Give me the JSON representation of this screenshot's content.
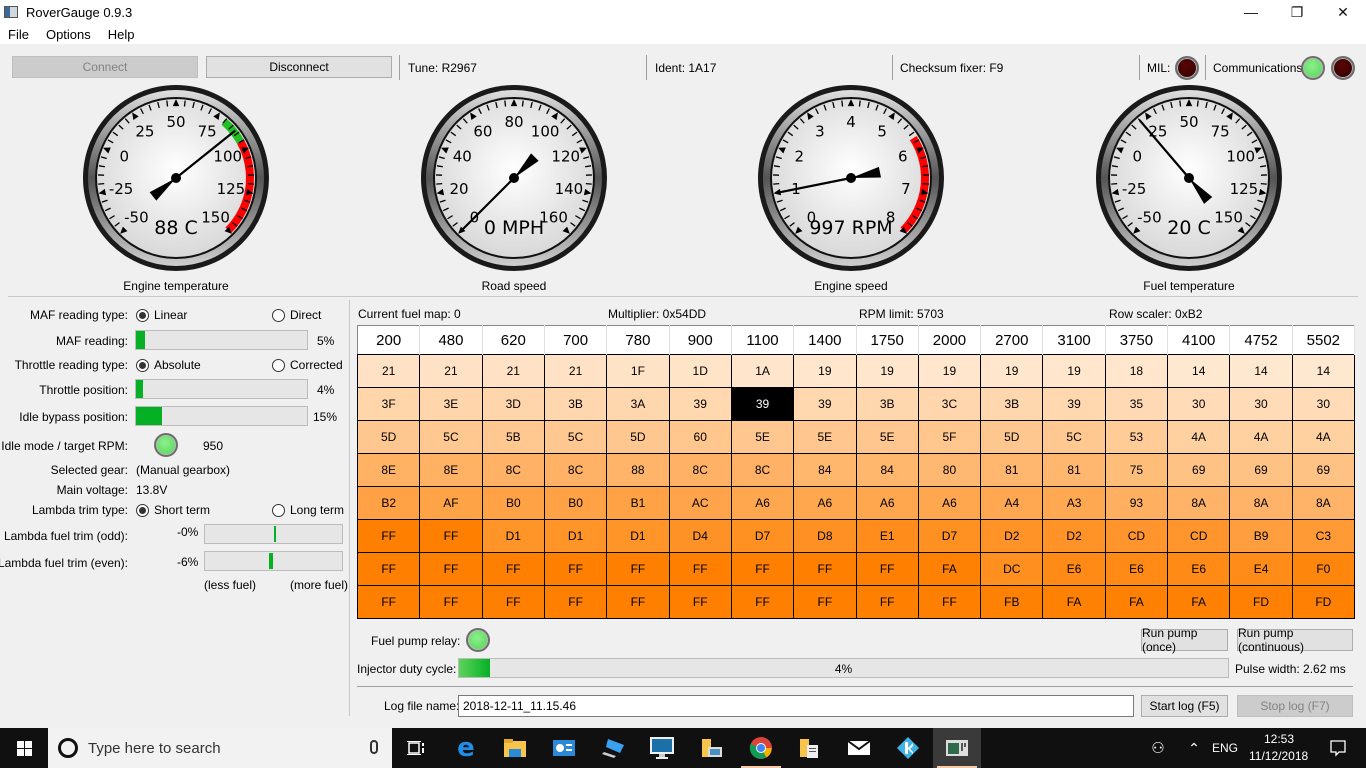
{
  "window": {
    "title": "RoverGauge 0.9.3",
    "controls": {
      "minimize": "—",
      "restore": "❐",
      "close": "✕"
    }
  },
  "menu": [
    "File",
    "Options",
    "Help"
  ],
  "toolbar": {
    "connect_label": "Connect",
    "connect_enabled": false,
    "disconnect_label": "Disconnect",
    "tune": "Tune: R2967",
    "ident": "Ident: 1A17",
    "checksum": "Checksum fixer: F9",
    "mil_label": "MIL:",
    "mil_state": "off",
    "comms_label": "Communications:",
    "comms_rx_state": "on",
    "comms_tx_state": "off"
  },
  "colors": {
    "led_on": "#4ed34e",
    "led_off": "#2a0000",
    "progress_fill": "#06b025",
    "redline": "#ff0000",
    "green_zone": "#1fc01f"
  },
  "gauges": [
    {
      "id": "engine-temp",
      "caption": "Engine temperature",
      "readout": "88 C",
      "value": 88,
      "min": -50,
      "max": 150,
      "ticks": [
        "-50",
        "-25",
        "0",
        "25",
        "50",
        "75",
        "100",
        "125",
        "150"
      ],
      "green_zone": [
        80,
        95
      ],
      "red_zone": [
        95,
        150
      ]
    },
    {
      "id": "road-speed",
      "caption": "Road speed",
      "readout": "0 MPH",
      "value": 0,
      "min": 0,
      "max": 160,
      "ticks": [
        "0",
        "20",
        "40",
        "60",
        "80",
        "100",
        "120",
        "140",
        "160"
      ],
      "green_zone": null,
      "red_zone": null
    },
    {
      "id": "engine-speed",
      "caption": "Engine speed",
      "readout": "997 RPM",
      "value": 0.997,
      "min": 0,
      "max": 8,
      "ticks": [
        "0",
        "1",
        "2",
        "3",
        "4",
        "5",
        "6",
        "7",
        "8"
      ],
      "green_zone": null,
      "red_zone": [
        5.7,
        8
      ]
    },
    {
      "id": "fuel-temp",
      "caption": "Fuel temperature",
      "readout": "20 C",
      "value": 20,
      "min": -50,
      "max": 150,
      "ticks": [
        "-50",
        "-25",
        "0",
        "25",
        "50",
        "75",
        "100",
        "125",
        "150"
      ],
      "green_zone": null,
      "red_zone": null
    }
  ],
  "left": {
    "maf_type_label": "MAF reading type:",
    "maf_type_options": [
      "Linear",
      "Direct"
    ],
    "maf_type_selected": "Linear",
    "maf_reading_label": "MAF reading:",
    "maf_reading_pct": 5,
    "maf_reading_text": "5%",
    "throttle_type_label": "Throttle reading type:",
    "throttle_type_options": [
      "Absolute",
      "Corrected"
    ],
    "throttle_type_selected": "Absolute",
    "throttle_pos_label": "Throttle position:",
    "throttle_pos_pct": 4,
    "throttle_pos_text": "4%",
    "idle_bypass_label": "Idle bypass position:",
    "idle_bypass_pct": 15,
    "idle_bypass_text": "15%",
    "idle_mode_label": "Idle mode / target RPM:",
    "idle_mode_state": "on",
    "idle_target_rpm": "950",
    "gear_label": "Selected gear:",
    "gear_value": "(Manual gearbox)",
    "voltage_label": "Main voltage:",
    "voltage_value": "13.8V",
    "lambda_type_label": "Lambda trim type:",
    "lambda_type_options": [
      "Short term",
      "Long term"
    ],
    "lambda_type_selected": "Short term",
    "lambda_odd_label": "Lambda fuel trim (odd):",
    "lambda_odd_text": "-0%",
    "lambda_odd_pct": 0,
    "lambda_even_label": "Lambda fuel trim (even):",
    "lambda_even_text": "-6%",
    "lambda_even_pct": -6,
    "less_fuel": "(less fuel)",
    "more_fuel": "(more fuel)"
  },
  "fuelmap": {
    "current_map": "Current fuel map: 0",
    "multiplier": "Multiplier: 0x54DD",
    "rpm_limit": "RPM limit: 5703",
    "row_scaler": "Row scaler: 0xB2",
    "columns": [
      "200",
      "480",
      "620",
      "700",
      "780",
      "900",
      "1100",
      "1400",
      "1750",
      "2000",
      "2700",
      "3100",
      "3750",
      "4100",
      "4752",
      "5502"
    ],
    "rows": [
      [
        "21",
        "21",
        "21",
        "21",
        "1F",
        "1D",
        "1A",
        "19",
        "19",
        "19",
        "19",
        "19",
        "18",
        "14",
        "14",
        "14"
      ],
      [
        "3F",
        "3E",
        "3D",
        "3B",
        "3A",
        "39",
        "39",
        "39",
        "3B",
        "3C",
        "3B",
        "39",
        "35",
        "30",
        "30",
        "30"
      ],
      [
        "5D",
        "5C",
        "5B",
        "5C",
        "5D",
        "60",
        "5E",
        "5E",
        "5E",
        "5F",
        "5D",
        "5C",
        "53",
        "4A",
        "4A",
        "4A"
      ],
      [
        "8E",
        "8E",
        "8C",
        "8C",
        "88",
        "8C",
        "8C",
        "84",
        "84",
        "80",
        "81",
        "81",
        "75",
        "69",
        "69",
        "69"
      ],
      [
        "B2",
        "AF",
        "B0",
        "B0",
        "B1",
        "AC",
        "A6",
        "A6",
        "A6",
        "A6",
        "A4",
        "A3",
        "93",
        "8A",
        "8A",
        "8A"
      ],
      [
        "FF",
        "FF",
        "D1",
        "D1",
        "D1",
        "D4",
        "D7",
        "D8",
        "E1",
        "D7",
        "D2",
        "D2",
        "CD",
        "CD",
        "B9",
        "C3"
      ],
      [
        "FF",
        "FF",
        "FF",
        "FF",
        "FF",
        "FF",
        "FF",
        "FF",
        "FF",
        "FA",
        "DC",
        "E6",
        "E6",
        "E6",
        "E4",
        "F0"
      ],
      [
        "FF",
        "FF",
        "FF",
        "FF",
        "FF",
        "FF",
        "FF",
        "FF",
        "FF",
        "FF",
        "FB",
        "FA",
        "FA",
        "FA",
        "FD",
        "FD"
      ]
    ],
    "selected_cell": {
      "row": 1,
      "col": 6
    }
  },
  "bottom": {
    "fuel_pump_label": "Fuel pump relay:",
    "fuel_pump_state": "on",
    "run_once": "Run pump (once)",
    "run_continuous": "Run pump (continuous)",
    "injector_label": "Injector duty cycle:",
    "injector_pct": 4,
    "injector_text": "4%",
    "pulse_width": "Pulse width: 2.62 ms",
    "log_label": "Log file name:",
    "log_value": "2018-12-11_11.15.46",
    "start_log": "Start log (F5)",
    "stop_log": "Stop log (F7)",
    "stop_log_enabled": false
  },
  "taskbar": {
    "search_placeholder": "Type here to search",
    "apps": [
      "task-view",
      "edge",
      "file-explorer",
      "control-panel",
      "this-pc",
      "lenovo-monitor",
      "photos-folder",
      "chrome",
      "documents-folder",
      "mail",
      "kodi",
      "rovergauge"
    ],
    "language": "ENG",
    "time": "12:53",
    "date": "11/12/2018"
  }
}
